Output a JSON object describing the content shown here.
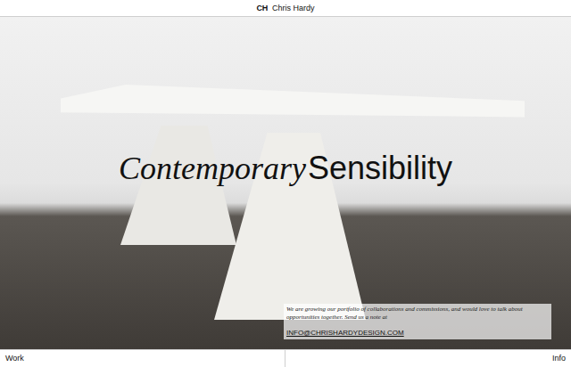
{
  "header": {
    "logo": "CH",
    "name": "Chris Hardy"
  },
  "hero": {
    "headline_italic": "Contemporary",
    "headline": "Sensibility",
    "note": "We are growing our portfolio of collaborations and commissions, and would love to talk about opportunities together. Send us a note at",
    "email": "INFO@CHRISHARDYDESIGN.COM"
  },
  "footer": {
    "nav": [
      {
        "label": "Work"
      },
      {
        "label": "Info"
      }
    ]
  }
}
